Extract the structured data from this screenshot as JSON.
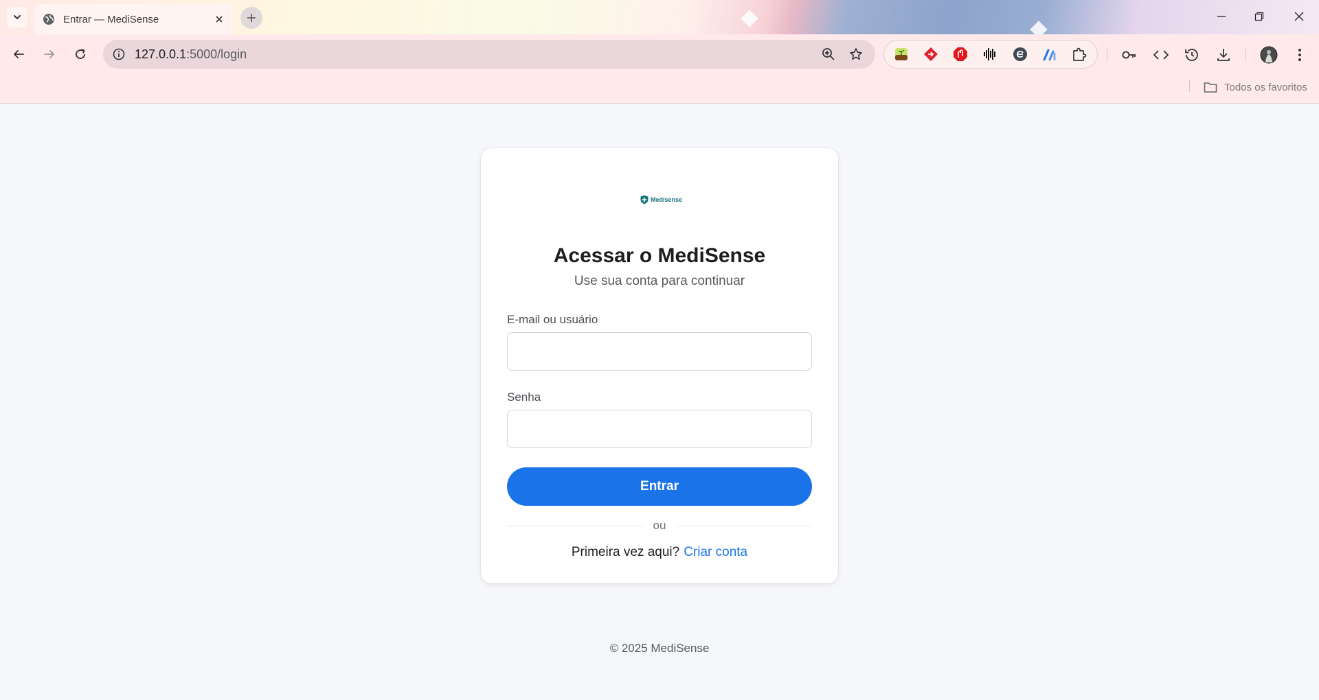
{
  "browser": {
    "tab_title": "Entrar — MediSense",
    "url_host": "127.0.0.1",
    "url_rest": ":5000/login",
    "bookmarks_label": "Todos os favoritos",
    "extensions": [
      "sprout-extension",
      "diamond-arrow-extension",
      "ad-block-extension",
      "audio-wave-extension",
      "e-extension",
      "chart-extension",
      "puzzle-extensions"
    ]
  },
  "card": {
    "logo_text": "Medisense",
    "title": "Acessar o MediSense",
    "subtitle": "Use sua conta para continuar",
    "email_label": "E-mail ou usuário",
    "email_value": "",
    "password_label": "Senha",
    "password_value": "",
    "submit_label": "Entrar",
    "divider_text": "ou",
    "signup_prompt": "Primeira vez aqui?",
    "signup_link": "Criar conta"
  },
  "footer": {
    "text": "© 2025 MediSense"
  },
  "colors": {
    "primary": "#1a73e8",
    "logo": "#14747a",
    "page_bg": "#f6f7fa"
  }
}
